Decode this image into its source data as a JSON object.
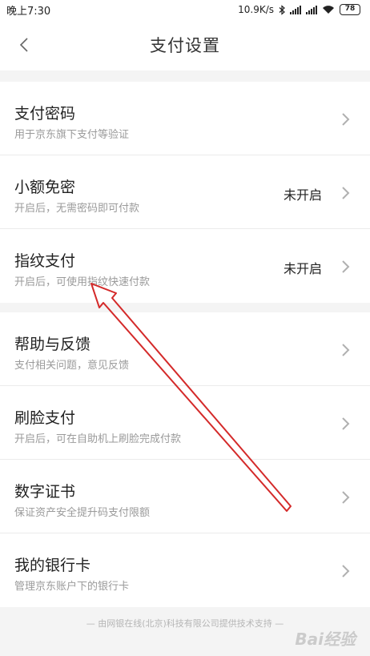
{
  "status_bar": {
    "time": "晚上7:30",
    "network_speed": "10.9K/s",
    "battery": "78",
    "icons": [
      "bluetooth-icon",
      "signal-icon",
      "wifi-icon",
      "battery-icon"
    ]
  },
  "header": {
    "title": "支付设置",
    "back_icon": "chevron-left-icon"
  },
  "groups": [
    {
      "items": [
        {
          "title": "支付密码",
          "subtitle": "用于京东旗下支付等验证",
          "status": ""
        },
        {
          "title": "小额免密",
          "subtitle": "开启后，无需密码即可付款",
          "status": "未开启"
        },
        {
          "title": "指纹支付",
          "subtitle": "开启后，可使用指纹快速付款",
          "status": "未开启"
        }
      ]
    },
    {
      "items": [
        {
          "title": "帮助与反馈",
          "subtitle": "支付相关问题，意见反馈",
          "status": ""
        },
        {
          "title": "刷脸支付",
          "subtitle": "开启后，可在自助机上刷脸完成付款",
          "status": ""
        },
        {
          "title": "数字证书",
          "subtitle": "保证资产安全提升码支付限额",
          "status": ""
        },
        {
          "title": "我的银行卡",
          "subtitle": "管理京东账户下的银行卡",
          "status": ""
        }
      ]
    }
  ],
  "footer": {
    "text": "— 由网银在线(北京)科技有限公司提供技术支持 —"
  },
  "watermark": {
    "text": "Bai经验"
  },
  "colors": {
    "annotation_arrow": "#d42a2a",
    "background": "#f4f4f4"
  }
}
